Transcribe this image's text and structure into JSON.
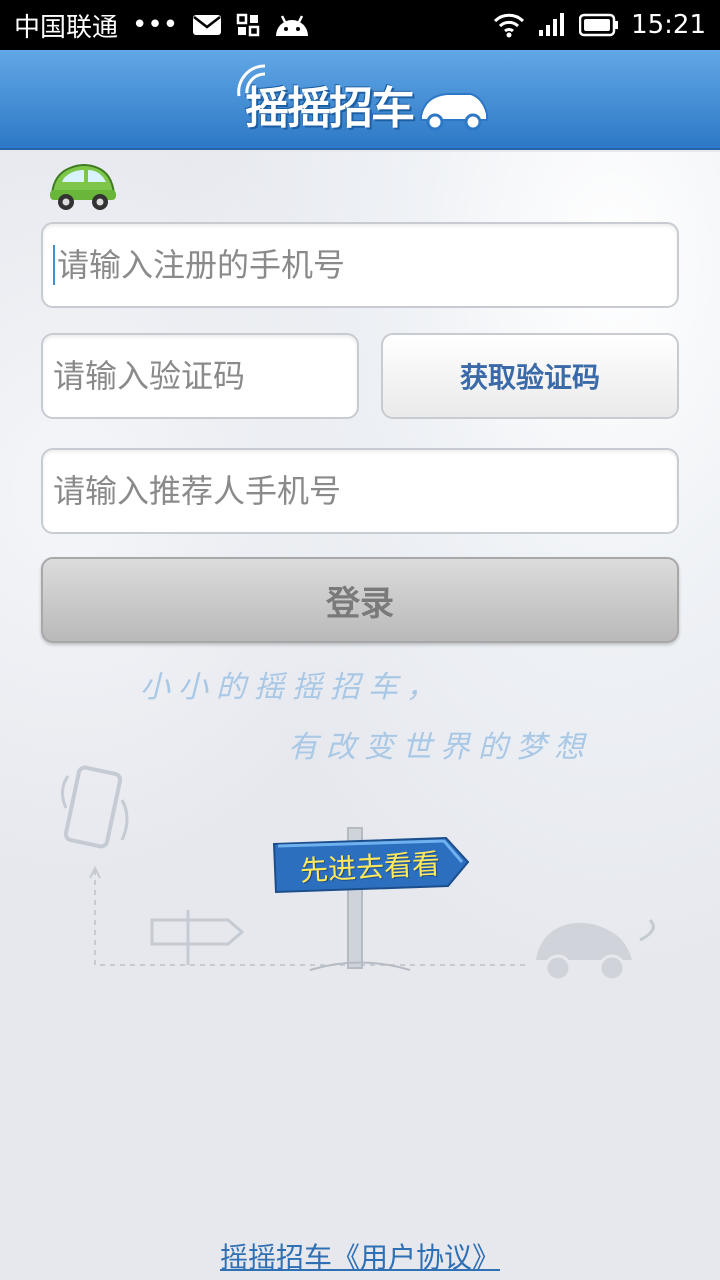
{
  "status_bar": {
    "carrier": "中国联通",
    "dots": "•••",
    "time": "15:21",
    "icons": [
      "mail-icon",
      "apps-icon",
      "android-icon",
      "wifi-icon",
      "signal-icon",
      "battery-icon"
    ]
  },
  "header": {
    "logo_text": "摇摇招车"
  },
  "form": {
    "phone_placeholder": "请输入注册的手机号",
    "code_placeholder": "请输入验证码",
    "get_code_label": "获取验证码",
    "referrer_placeholder": "请输入推荐人手机号",
    "login_label": "登录"
  },
  "slogan": {
    "line1": "小小的摇摇招车，",
    "line2": "有改变世界的梦想"
  },
  "sign": {
    "label": "先进去看看"
  },
  "footer": {
    "agreement_link": "摇摇招车《用户协议》"
  },
  "colors": {
    "header_top": "#62a8e6",
    "header_bottom": "#2d78c6",
    "link": "#2f6fb3",
    "button_text": "#3b6aa8"
  }
}
